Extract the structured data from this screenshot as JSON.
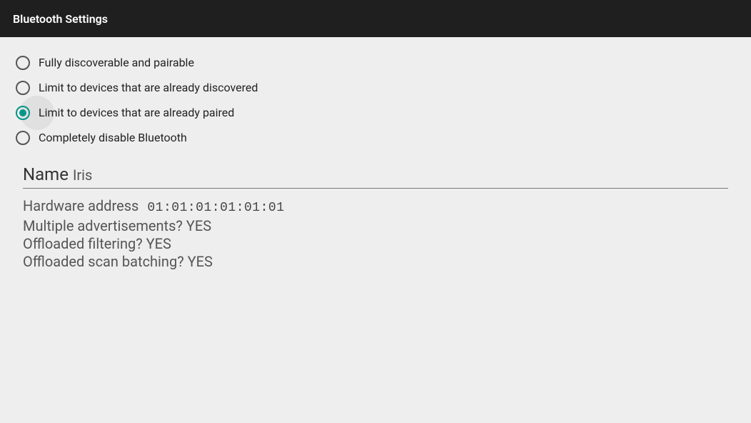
{
  "appbar": {
    "title": "Bluetooth Settings"
  },
  "radio": {
    "selectedIndex": 2,
    "options": [
      {
        "label": "Fully discoverable and pairable"
      },
      {
        "label": "Limit to devices that are already discovered"
      },
      {
        "label": "Limit to devices that are already paired"
      },
      {
        "label": "Completely disable Bluetooth"
      }
    ]
  },
  "name": {
    "label": "Name",
    "value": "Iris"
  },
  "info": {
    "hardwareAddressLabel": "Hardware address",
    "hardwareAddressValue": "01:01:01:01:01:01",
    "multipleAdsText": "Multiple advertisements? YES",
    "offloadedFilteringText": "Offloaded filtering? YES",
    "offloadedScanBatchingText": "Offloaded scan batching? YES"
  },
  "colors": {
    "accent": "#009688",
    "appbar": "#1f1f1f",
    "background": "#eeeeee"
  }
}
